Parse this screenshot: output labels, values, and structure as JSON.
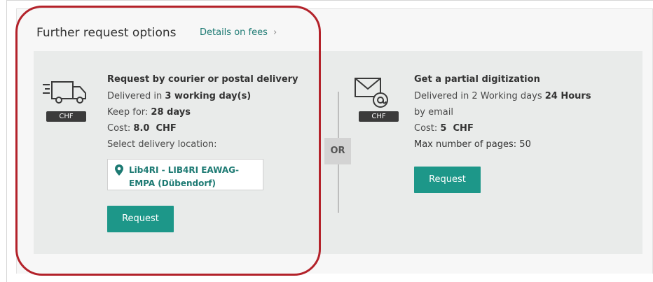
{
  "header": {
    "title": "Further request options",
    "fees_link": "Details on fees",
    "fees_chevron": "›"
  },
  "courier": {
    "icon": "delivery-truck-icon",
    "badge": "CHF",
    "title": "Request by courier or postal delivery",
    "delivered_prefix": "Delivered in ",
    "delivered_value": "3 working day(s)",
    "keep_prefix": "Keep for: ",
    "keep_value": "28 days",
    "cost_prefix": "Cost: ",
    "cost_value": "8.0  CHF",
    "location_label": "Select delivery location:",
    "location_icon": "map-pin-icon",
    "location_value": "Lib4RI - LIB4RI EAWAG-EMPA (Dübendorf)",
    "button": "Request"
  },
  "separator": {
    "label": "OR"
  },
  "digitization": {
    "icon": "email-at-icon",
    "badge": "CHF",
    "title": "Get a partial digitization",
    "delivered_prefix": "Delivered in 2 Working days ",
    "delivered_value": "24 Hours",
    "delivered_suffix": "by email",
    "cost_prefix": "Cost: ",
    "cost_value": "5  CHF",
    "max_pages": "Max number of pages: 50",
    "button": "Request"
  },
  "colors": {
    "accent": "#1d9789",
    "link": "#1d7a73",
    "highlight": "#b3222a"
  }
}
